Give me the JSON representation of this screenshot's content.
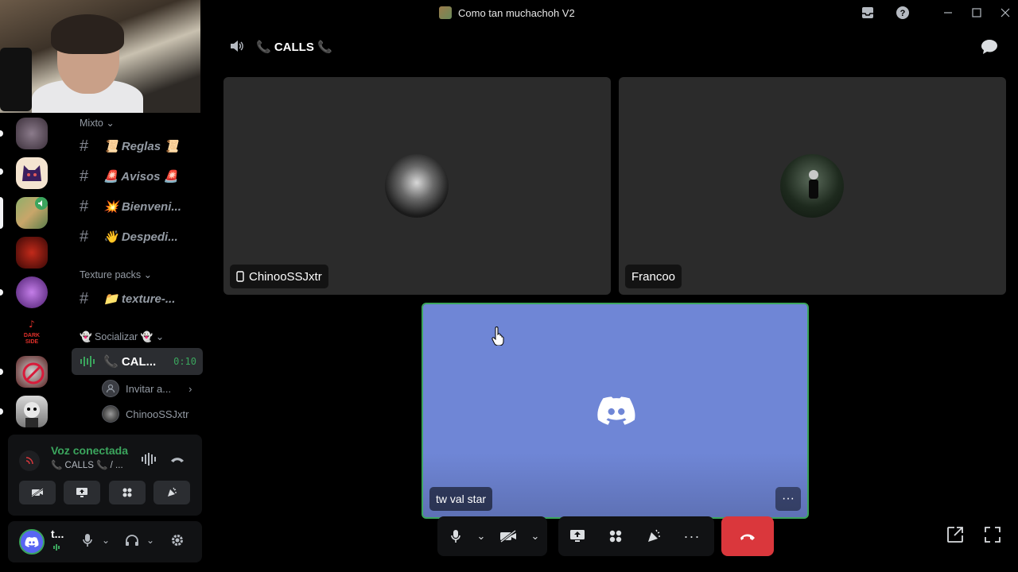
{
  "window": {
    "title": "Como tan muchachoh V2",
    "controls": [
      "inbox-icon",
      "help-icon",
      "minimize-icon",
      "maximize-icon",
      "close-icon"
    ]
  },
  "sidebar": {
    "categories": [
      {
        "label": "Mixto"
      },
      {
        "label": "Texture packs"
      },
      {
        "label": "👻 Socializar 👻"
      }
    ],
    "channels": [
      {
        "label": "📜 Reglas 📜"
      },
      {
        "label": "🚨 Avisos 🚨"
      },
      {
        "label": "💥 Bienveni..."
      },
      {
        "label": "👋 Despedi..."
      },
      {
        "label": "📁 texture-..."
      }
    ],
    "voice_channel": {
      "label": "📞 CAL...",
      "timer": "0:10"
    },
    "invite_label": "Invitar a...",
    "voice_member": "ChinooSSJxtr"
  },
  "voice_panel": {
    "status": "Voz conectada",
    "channel": "📞 CALLS 📞 / ..."
  },
  "user_panel": {
    "username": "t..."
  },
  "main": {
    "header_title": "📞 CALLS 📞",
    "participants": [
      {
        "name": "ChinooSSJxtr",
        "device": "mobile-icon"
      },
      {
        "name": "Francoo"
      },
      {
        "name": "tw val star",
        "speaking": true
      }
    ]
  },
  "colors": {
    "accent_blue": "#6f86d6",
    "speaking_green": "#3ba55d",
    "hangup_red": "#da373c",
    "connected_green": "#3ba55d"
  }
}
